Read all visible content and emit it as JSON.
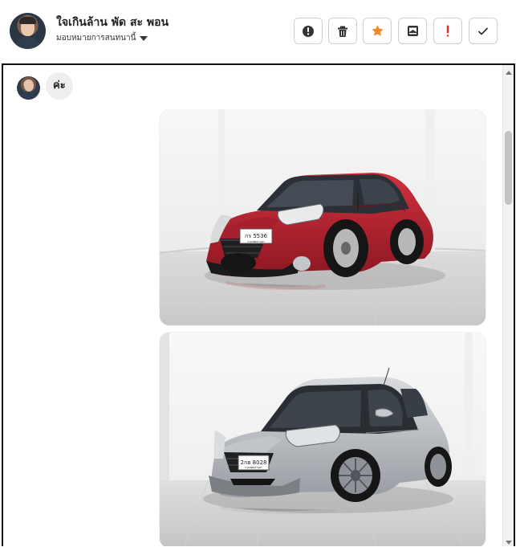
{
  "header": {
    "contact_name": "ใจเกินล้าน พัด สะ พอน",
    "assignee_label": "มอบหมายการสนทนานี้",
    "actions": [
      {
        "name": "info",
        "icon": "info-icon"
      },
      {
        "name": "delete",
        "icon": "trash-icon"
      },
      {
        "name": "star",
        "icon": "star-icon"
      },
      {
        "name": "archive",
        "icon": "archive-icon"
      },
      {
        "name": "important",
        "icon": "exclamation-icon"
      },
      {
        "name": "done",
        "icon": "check-icon"
      }
    ]
  },
  "chat": {
    "message_text": "ค่ะ",
    "images": [
      {
        "plate": "กร 5536",
        "province": "กรุงเทพมหานคร",
        "car_color": "#c8212e"
      },
      {
        "plate": "2กฮ 8028",
        "province": "กรุงเทพมหานคร",
        "car_color": "#bfc2c6"
      }
    ]
  },
  "colors": {
    "accent_orange": "#f08a24",
    "danger_red": "#e22b2b",
    "border_dark": "#111111"
  }
}
